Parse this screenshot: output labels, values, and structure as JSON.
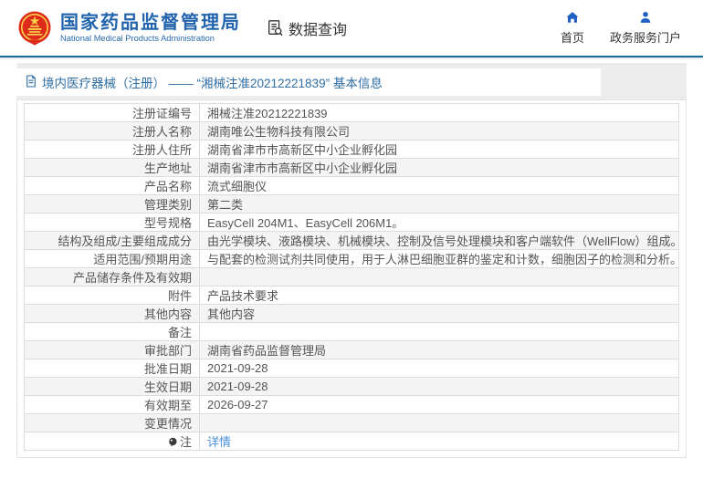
{
  "header": {
    "title": "国家药品监督管理局",
    "subtitle": "National Medical Products Administration",
    "data_query_label": "数据查询",
    "nav": [
      {
        "label": "首页",
        "icon": "home-icon"
      },
      {
        "label": "政务服务门户",
        "icon": "user-icon"
      }
    ]
  },
  "breadcrumb": {
    "text": "境内医疗器械（注册） —— “湘械注准20212221839” 基本信息"
  },
  "table": {
    "rows": [
      {
        "label": "注册证编号",
        "value": "湘械注准20212221839"
      },
      {
        "label": "注册人名称",
        "value": "湖南唯公生物科技有限公司"
      },
      {
        "label": "注册人住所",
        "value": "湖南省津市市高新区中小企业孵化园"
      },
      {
        "label": "生产地址",
        "value": "湖南省津市市高新区中小企业孵化园"
      },
      {
        "label": "产品名称",
        "value": "流式细胞仪"
      },
      {
        "label": "管理类别",
        "value": "第二类"
      },
      {
        "label": "型号规格",
        "value": "EasyCell 204M1、EasyCell 206M1。"
      },
      {
        "label": "结构及组成/主要组成成分",
        "value": "由光学模块、液路模块、机械模块、控制及信号处理模块和客户端软件（WellFlow）组成。"
      },
      {
        "label": "适用范围/预期用途",
        "value": "与配套的检测试剂共同使用，用于人淋巴细胞亚群的鉴定和计数，细胞因子的检测和分析。"
      },
      {
        "label": "产品储存条件及有效期",
        "value": ""
      },
      {
        "label": "附件",
        "value": "产品技术要求"
      },
      {
        "label": "其他内容",
        "value": "其他内容"
      },
      {
        "label": "备注",
        "value": ""
      },
      {
        "label": "审批部门",
        "value": "湖南省药品监督管理局"
      },
      {
        "label": "批准日期",
        "value": "2021-09-28"
      },
      {
        "label": "生效日期",
        "value": "2021-09-28"
      },
      {
        "label": "有效期至",
        "value": "2026-09-27"
      },
      {
        "label": "变更情况",
        "value": ""
      },
      {
        "label": "注",
        "value": "详情",
        "link": true,
        "icon": "note-icon"
      }
    ]
  },
  "colors": {
    "brand_blue": "#2263ae",
    "divider_blue": "#1e6a9b",
    "link_blue": "#4a90d9",
    "row_alt_bg": "#f4f4f4",
    "emblem_red": "#dd2a1b",
    "emblem_gold": "#f9d24a"
  }
}
